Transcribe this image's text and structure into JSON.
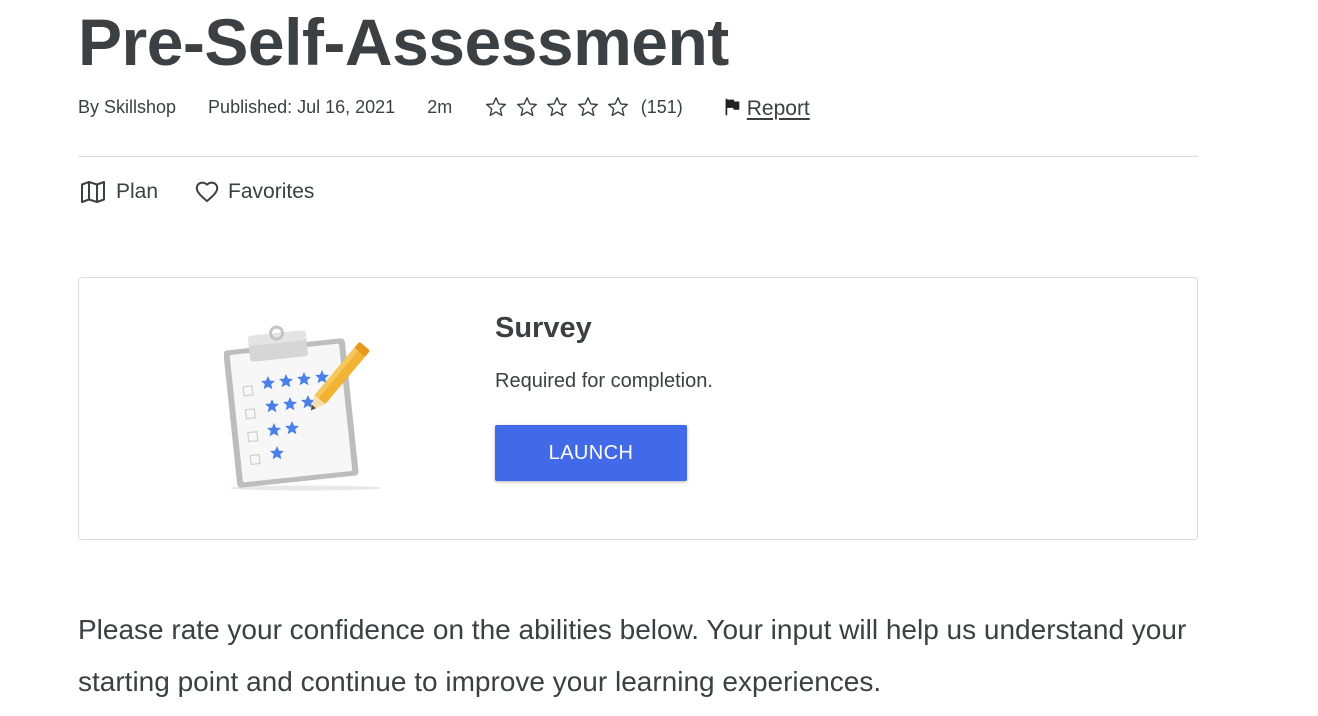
{
  "page": {
    "title": "Pre-Self-Assessment"
  },
  "meta": {
    "author": "By Skillshop",
    "published": "Published: Jul 16, 2021",
    "duration": "2m",
    "rating_stars_filled": 0,
    "rating_stars_total": 5,
    "rating_count": "(151)",
    "report_label": "Report"
  },
  "actions": {
    "plan_label": "Plan",
    "favorites_label": "Favorites"
  },
  "card": {
    "title": "Survey",
    "subtitle": "Required for completion.",
    "launch_label": "LAUNCH"
  },
  "description": "Please rate your confidence on the abilities below. Your input will help us understand your starting point and continue to improve your learning experiences.",
  "colors": {
    "accent": "#4169e8",
    "text": "#3c4043",
    "divider": "#dadce0",
    "illustration_star": "#4a80e8",
    "pencil": "#f2b233"
  },
  "icons": {
    "star": "star-outline-icon",
    "report": "flag-icon",
    "plan": "map-icon",
    "favorites": "heart-outline-icon"
  }
}
